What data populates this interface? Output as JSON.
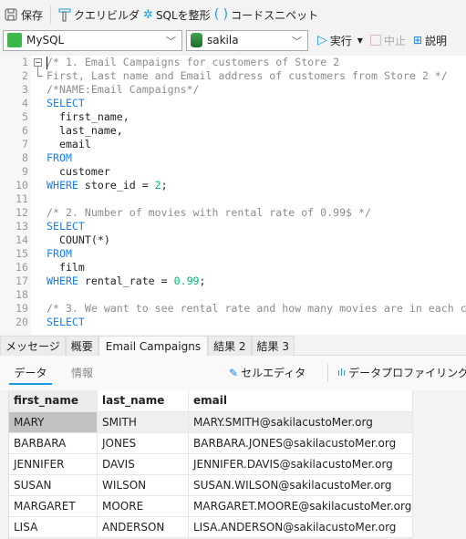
{
  "toolbar": {
    "save": "保存",
    "query_builder": "クエリビルダ",
    "format_sql": "SQLを整形",
    "snippets": "コードスニペット"
  },
  "connection": {
    "type": "MySQL",
    "database": "sakila",
    "run": "実行",
    "stop": "中止",
    "explain": "説明"
  },
  "colors": {
    "keyword": "#1a7fe0",
    "comment": "#8c8c8c",
    "number": "#00b86b",
    "text": "#222222",
    "accent": "#1a9be0"
  },
  "editor": {
    "lines": [
      {
        "n": "1",
        "segs": [
          {
            "t": "/* 1. Email Campaigns for customers of Store 2",
            "k": "comment"
          }
        ]
      },
      {
        "n": "2",
        "segs": [
          {
            "t": "First, Last name and Email address of customers from Store 2 */",
            "k": "comment"
          }
        ]
      },
      {
        "n": "3",
        "segs": [
          {
            "t": "/*NAME:Email Campaigns*/",
            "k": "comment"
          }
        ]
      },
      {
        "n": "4",
        "segs": [
          {
            "t": "SELECT",
            "k": "keyword"
          }
        ]
      },
      {
        "n": "5",
        "segs": [
          {
            "t": "  first_name,",
            "k": "text"
          }
        ]
      },
      {
        "n": "6",
        "segs": [
          {
            "t": "  last_name,",
            "k": "text"
          }
        ]
      },
      {
        "n": "7",
        "segs": [
          {
            "t": "  email",
            "k": "text"
          }
        ]
      },
      {
        "n": "8",
        "segs": [
          {
            "t": "FROM",
            "k": "keyword"
          }
        ]
      },
      {
        "n": "9",
        "segs": [
          {
            "t": "  customer",
            "k": "text"
          }
        ]
      },
      {
        "n": "10",
        "segs": [
          {
            "t": "WHERE",
            "k": "keyword"
          },
          {
            "t": " store_id = ",
            "k": "text"
          },
          {
            "t": "2",
            "k": "number"
          },
          {
            "t": ";",
            "k": "text"
          }
        ]
      },
      {
        "n": "11",
        "segs": []
      },
      {
        "n": "12",
        "segs": [
          {
            "t": "/* 2. Number of movies with rental rate of 0.99$ */",
            "k": "comment"
          }
        ]
      },
      {
        "n": "13",
        "segs": [
          {
            "t": "SELECT",
            "k": "keyword"
          }
        ]
      },
      {
        "n": "14",
        "segs": [
          {
            "t": "  COUNT(*)",
            "k": "text"
          }
        ]
      },
      {
        "n": "15",
        "segs": [
          {
            "t": "FROM",
            "k": "keyword"
          }
        ]
      },
      {
        "n": "16",
        "segs": [
          {
            "t": "  film",
            "k": "text"
          }
        ]
      },
      {
        "n": "17",
        "segs": [
          {
            "t": "WHERE",
            "k": "keyword"
          },
          {
            "t": " rental_rate = ",
            "k": "text"
          },
          {
            "t": "0.99",
            "k": "number"
          },
          {
            "t": ";",
            "k": "text"
          }
        ]
      },
      {
        "n": "18",
        "segs": []
      },
      {
        "n": "19",
        "segs": [
          {
            "t": "/* 3. We want to see rental rate and how many movies are in each c",
            "k": "comment"
          }
        ]
      },
      {
        "n": "20",
        "segs": [
          {
            "t": "SELECT",
            "k": "keyword"
          }
        ]
      }
    ]
  },
  "result_tabs": [
    "メッセージ",
    "概要",
    "Email Campaigns",
    "結果 2",
    "結果 3"
  ],
  "active_tab": 2,
  "subtabs": {
    "data": "データ",
    "info": "情報",
    "cell_editor": "セルエディタ",
    "data_profiling": "データプロファイリング"
  },
  "grid": {
    "columns": [
      "first_name",
      "last_name",
      "email"
    ],
    "rows": [
      [
        "MARY",
        "SMITH",
        "MARY.SMITH@sakilacustoMer.org"
      ],
      [
        "BARBARA",
        "JONES",
        "BARBARA.JONES@sakilacustoMer.org"
      ],
      [
        "JENNIFER",
        "DAVIS",
        "JENNIFER.DAVIS@sakilacustoMer.org"
      ],
      [
        "SUSAN",
        "WILSON",
        "SUSAN.WILSON@sakilacustoMer.org"
      ],
      [
        "MARGARET",
        "MOORE",
        "MARGARET.MOORE@sakilacustoMer.org"
      ],
      [
        "LISA",
        "ANDERSON",
        "LISA.ANDERSON@sakilacustoMer.org"
      ]
    ]
  }
}
